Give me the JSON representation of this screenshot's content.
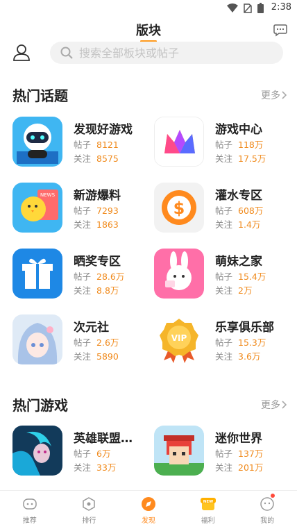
{
  "status_bar": {
    "time": "2:38"
  },
  "header": {
    "title": "版块"
  },
  "search": {
    "placeholder": "搜索全部板块或帖子"
  },
  "hot_topics": {
    "title": "热门话题",
    "more_label": "更多",
    "stat_labels": {
      "posts": "帖子",
      "follows": "关注"
    },
    "items": [
      {
        "name": "发现好游戏",
        "posts": "8121",
        "follows": "8575",
        "icon": "robot-mascot-icon"
      },
      {
        "name": "游戏中心",
        "posts": "118万",
        "follows": "17.5万",
        "icon": "crown-icon"
      },
      {
        "name": "新游爆料",
        "posts": "7293",
        "follows": "1863",
        "icon": "chick-news-icon"
      },
      {
        "name": "灌水专区",
        "posts": "608万",
        "follows": "1.4万",
        "icon": "coin-icon"
      },
      {
        "name": "晒奖专区",
        "posts": "28.6万",
        "follows": "8.8万",
        "icon": "gift-icon"
      },
      {
        "name": "萌妹之家",
        "posts": "15.4万",
        "follows": "2万",
        "icon": "bunny-icon"
      },
      {
        "name": "次元社",
        "posts": "2.6万",
        "follows": "5890",
        "icon": "anime-girl-icon"
      },
      {
        "name": "乐享俱乐部",
        "posts": "15.3万",
        "follows": "3.6万",
        "icon": "vip-medal-icon"
      }
    ]
  },
  "hot_games": {
    "title": "热门游戏",
    "more_label": "更多",
    "items": [
      {
        "name": "英雄联盟…",
        "posts": "6万",
        "follows": "33万",
        "icon": "lol-hero-icon"
      },
      {
        "name": "迷你世界",
        "posts": "137万",
        "follows": "201万",
        "icon": "mini-world-icon"
      }
    ]
  },
  "tabbar": {
    "items": [
      {
        "label": "推荐",
        "icon": "gamepad-face-icon"
      },
      {
        "label": "排行",
        "icon": "ranking-icon"
      },
      {
        "label": "发现",
        "icon": "compass-icon"
      },
      {
        "label": "福利",
        "icon": "gift-new-icon"
      },
      {
        "label": "我的",
        "icon": "profile-face-icon"
      }
    ],
    "accent": "#ff8a1e"
  }
}
